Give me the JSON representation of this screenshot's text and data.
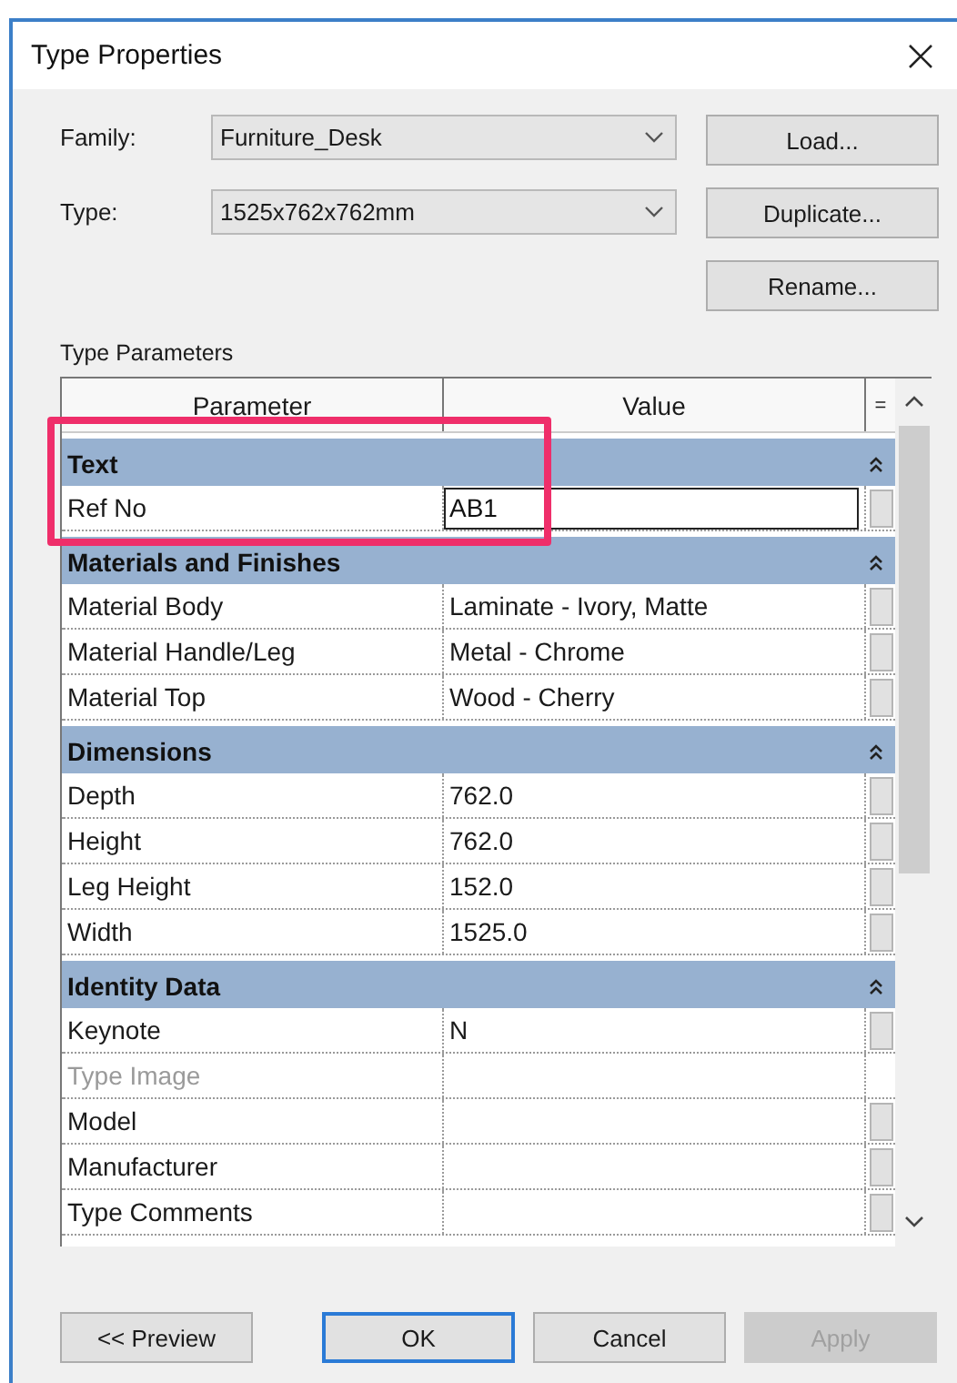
{
  "window": {
    "title": "Type Properties"
  },
  "selectors": [
    {
      "label": "Family:",
      "value": "Furniture_Desk"
    },
    {
      "label": "Type:",
      "value": "1525x762x762mm"
    }
  ],
  "side_buttons": [
    "Load...",
    "Duplicate...",
    "Rename..."
  ],
  "section_label": "Type Parameters",
  "table": {
    "columns": [
      "Parameter",
      "Value",
      "="
    ],
    "groups": [
      {
        "name": "Text",
        "expanded": true,
        "rows": [
          {
            "parameter": "Ref No",
            "value": "AB1",
            "kind": "input",
            "disabled": false
          }
        ]
      },
      {
        "name": "Materials and Finishes",
        "expanded": true,
        "rows": [
          {
            "parameter": "Material Body",
            "value": "Laminate - Ivory, Matte",
            "kind": "text",
            "disabled": false
          },
          {
            "parameter": "Material Handle/Leg",
            "value": "Metal - Chrome",
            "kind": "text",
            "disabled": false
          },
          {
            "parameter": "Material Top",
            "value": "Wood - Cherry",
            "kind": "text",
            "disabled": false
          }
        ]
      },
      {
        "name": "Dimensions",
        "expanded": true,
        "rows": [
          {
            "parameter": "Depth",
            "value": "762.0",
            "kind": "text",
            "disabled": false
          },
          {
            "parameter": "Height",
            "value": "762.0",
            "kind": "text",
            "disabled": false
          },
          {
            "parameter": "Leg Height",
            "value": "152.0",
            "kind": "text",
            "disabled": false
          },
          {
            "parameter": "Width",
            "value": "1525.0",
            "kind": "text",
            "disabled": false
          }
        ]
      },
      {
        "name": "Identity Data",
        "expanded": true,
        "rows": [
          {
            "parameter": "Keynote",
            "value": "N",
            "kind": "text",
            "disabled": false
          },
          {
            "parameter": "Type Image",
            "kind": "text",
            "disabled": true
          },
          {
            "parameter": "Model",
            "kind": "text",
            "disabled": false
          },
          {
            "parameter": "Manufacturer",
            "kind": "text",
            "disabled": false
          },
          {
            "parameter": "Type Comments",
            "kind": "text",
            "disabled": false
          }
        ]
      }
    ]
  },
  "buttons": [
    {
      "label": "<< Preview",
      "default": false,
      "disabled": false
    },
    {
      "label": "OK",
      "default": true,
      "disabled": false
    },
    {
      "label": "Cancel",
      "default": false,
      "disabled": false
    },
    {
      "label": "Apply",
      "default": false,
      "disabled": true
    }
  ]
}
